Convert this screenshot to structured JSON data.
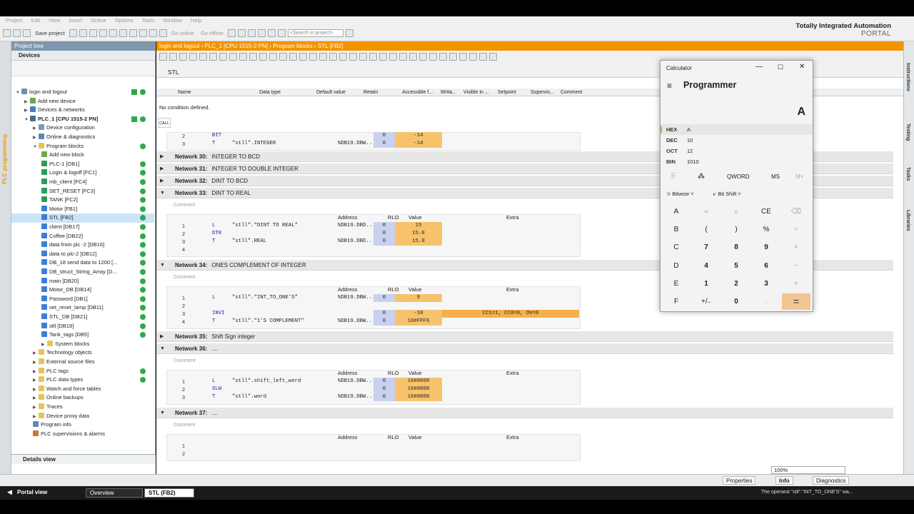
{
  "menu": [
    "Project",
    "Edit",
    "View",
    "Insert",
    "Online",
    "Options",
    "Tools",
    "Window",
    "Help"
  ],
  "toolbar": {
    "save_label": "Save project",
    "go_online": "Go online",
    "go_offline": "Go offline",
    "search_placeholder": "<Search in project>"
  },
  "brand": {
    "line1": "Totally Integrated Automation",
    "line2": "PORTAL"
  },
  "sidetab": "PLC programming",
  "project_tree": {
    "title": "Project tree",
    "tab": "Devices",
    "items": [
      {
        "label": "login and logout",
        "indent": 0,
        "icon": "project",
        "status": "check"
      },
      {
        "label": "Add new device",
        "indent": 1,
        "icon": "add"
      },
      {
        "label": "Devices & networks",
        "indent": 1,
        "icon": "network"
      },
      {
        "label": "PLC_1 [CPU 1515-2 PN]",
        "indent": 1,
        "icon": "plc",
        "status": "check",
        "bold": true
      },
      {
        "label": "Device configuration",
        "indent": 2,
        "icon": "config"
      },
      {
        "label": "Online & diagnostics",
        "indent": 2,
        "icon": "diag"
      },
      {
        "label": "Program blocks",
        "indent": 2,
        "icon": "folder",
        "status": "ok"
      },
      {
        "label": "Add new block",
        "indent": 3,
        "icon": "add"
      },
      {
        "label": "PLC-1 [OB1]",
        "indent": 3,
        "icon": "ob",
        "status": "ok"
      },
      {
        "label": "Login & logoff [FC1]",
        "indent": 3,
        "icon": "fc",
        "status": "ok"
      },
      {
        "label": "mb_client [FC4]",
        "indent": 3,
        "icon": "fc",
        "status": "ok"
      },
      {
        "label": "SET_RESET [FC3]",
        "indent": 3,
        "icon": "fc",
        "status": "ok"
      },
      {
        "label": "TANK [FC2]",
        "indent": 3,
        "icon": "fc",
        "status": "ok"
      },
      {
        "label": "Motor [FB1]",
        "indent": 3,
        "icon": "fb",
        "status": "ok"
      },
      {
        "label": "STL [FB2]",
        "indent": 3,
        "icon": "fb",
        "status": "ok",
        "selected": true
      },
      {
        "label": "client [DB17]",
        "indent": 3,
        "icon": "db",
        "status": "ok"
      },
      {
        "label": "Coffee [DB22]",
        "indent": 3,
        "icon": "db",
        "status": "ok"
      },
      {
        "label": "data from plc -2 [DB16]",
        "indent": 3,
        "icon": "db",
        "status": "ok"
      },
      {
        "label": "data to plc-2 [DB12]",
        "indent": 3,
        "icon": "db",
        "status": "ok"
      },
      {
        "label": "DB_18 send data to 1200 [...",
        "indent": 3,
        "icon": "db",
        "status": "ok"
      },
      {
        "label": "DB_struct_String_Array [D...",
        "indent": 3,
        "icon": "db",
        "status": "ok"
      },
      {
        "label": "main [DB20]",
        "indent": 3,
        "icon": "db",
        "status": "ok"
      },
      {
        "label": "Motor_DB [DB14]",
        "indent": 3,
        "icon": "db",
        "status": "ok"
      },
      {
        "label": "Password [DB1]",
        "indent": 3,
        "icon": "db",
        "status": "ok"
      },
      {
        "label": "set_reset_lamp [DB11]",
        "indent": 3,
        "icon": "db",
        "status": "ok"
      },
      {
        "label": "STL_DB [DB21]",
        "indent": 3,
        "icon": "db",
        "status": "ok"
      },
      {
        "label": "stll [DB19]",
        "indent": 3,
        "icon": "db",
        "status": "ok"
      },
      {
        "label": "Tank_tags [DB5]",
        "indent": 3,
        "icon": "db",
        "status": "ok"
      },
      {
        "label": "System blocks",
        "indent": 3,
        "icon": "folder"
      },
      {
        "label": "Technology objects",
        "indent": 2,
        "icon": "folder"
      },
      {
        "label": "External source files",
        "indent": 2,
        "icon": "folder"
      },
      {
        "label": "PLC tags",
        "indent": 2,
        "icon": "folder",
        "status": "ok"
      },
      {
        "label": "PLC data types",
        "indent": 2,
        "icon": "folder",
        "status": "ok"
      },
      {
        "label": "Watch and force tables",
        "indent": 2,
        "icon": "folder"
      },
      {
        "label": "Online backups",
        "indent": 2,
        "icon": "folder"
      },
      {
        "label": "Traces",
        "indent": 2,
        "icon": "folder"
      },
      {
        "label": "Device proxy data",
        "indent": 2,
        "icon": "folder"
      },
      {
        "label": "Program info",
        "indent": 2,
        "icon": "info"
      },
      {
        "label": "PLC supervisions & alarms",
        "indent": 2,
        "icon": "alarm"
      }
    ],
    "details": "Details view"
  },
  "editor": {
    "breadcrumb": "login and logout  ›  PLC_1 [CPU 1515-2 PN]  ›  Program blocks  ›  STL [FB2]",
    "lang": "STL",
    "interface_cols": [
      "Name",
      "Data type",
      "Default value",
      "Retain",
      "Accessible f...",
      "Writa...",
      "Visible in ...",
      "Setpoint",
      "Supervis...",
      "Comment"
    ],
    "condition": "No condition defined.",
    "call": "CALL",
    "col_headers": {
      "address": "Address",
      "rlo": "RLO",
      "value": "Value",
      "extra": "Extra"
    },
    "comment_placeholder": "Comment",
    "top_lines": [
      {
        "no": "2",
        "ins": "BIT",
        "opd": "",
        "addr": "",
        "rlo": "0",
        "val": "-14"
      },
      {
        "no": "3",
        "ins": "T",
        "opd": "\"stll\".INTEGER",
        "addr": "%DB19.DBW...",
        "rlo": "0",
        "val": "-14"
      }
    ],
    "networks": [
      {
        "id": "n30",
        "title": "Network 30:",
        "desc": "INTEGER TO BCD",
        "open": false
      },
      {
        "id": "n31",
        "title": "Network 31:",
        "desc": "INTEGER TO DOUBLE INTEGER",
        "open": false
      },
      {
        "id": "n32",
        "title": "Network 32:",
        "desc": "DINT TO BCD",
        "open": false
      },
      {
        "id": "n33",
        "title": "Network 33:",
        "desc": "DINT TO REAL",
        "open": true,
        "lines": [
          {
            "no": "1",
            "ins": "L",
            "opd": "\"stll\".\"DINT TO REAL\"",
            "addr": "%DB19.DBD...",
            "rlo": "0",
            "val": "15"
          },
          {
            "no": "2",
            "ins": "DTR",
            "opd": "",
            "addr": "",
            "rlo": "0",
            "val": "15.0"
          },
          {
            "no": "3",
            "ins": "T",
            "opd": "\"stll\".REAL",
            "addr": "%DB19.DBD...",
            "rlo": "0",
            "val": "15.0"
          },
          {
            "no": "4",
            "ins": "",
            "opd": "",
            "addr": "",
            "rlo": "",
            "val": ""
          }
        ]
      },
      {
        "id": "n34",
        "title": "Network 34:",
        "desc": "ONES COMPLEMENT OF INTEGER",
        "open": true,
        "lines": [
          {
            "no": "1",
            "ins": "L",
            "opd": "\"stll\".\"INT_TO_ONE'S\"",
            "addr": "%DB19.DBW...",
            "rlo": "0",
            "val": "9"
          },
          {
            "no": "2",
            "ins": "",
            "opd": "",
            "addr": "",
            "rlo": "",
            "val": ""
          },
          {
            "no": "3",
            "ins": "INVI",
            "opd": "",
            "addr": "",
            "rlo": "0",
            "val": "-10",
            "ext": "CC1=1, CC0=0, OV=0"
          },
          {
            "no": "4",
            "ins": "T",
            "opd": "\"stll\".\"1'S COMPLEMENT\"",
            "addr": "%DB19.DBW...",
            "rlo": "0",
            "val": "16#FFF6"
          }
        ]
      },
      {
        "id": "n35",
        "title": "Network 35:",
        "desc": "Shift Sign integer",
        "open": false
      },
      {
        "id": "n36",
        "title": "Network 36:",
        "desc": "....",
        "open": true,
        "lines": [
          {
            "no": "1",
            "ins": "L",
            "opd": "\"stll\".shift_left_word",
            "addr": "%DB19.DBW...",
            "rlo": "0",
            "val": "16#0000"
          },
          {
            "no": "2",
            "ins": "SLW",
            "opd": "",
            "addr": "",
            "rlo": "0",
            "val": "16#0000"
          },
          {
            "no": "3",
            "ins": "T",
            "opd": "\"stll\".word",
            "addr": "%DB19.DBW...",
            "rlo": "0",
            "val": "16#0000"
          }
        ]
      },
      {
        "id": "n37",
        "title": "Network 37:",
        "desc": "....",
        "open": true,
        "lines": [
          {
            "no": "1",
            "ins": "",
            "opd": "",
            "addr": "",
            "rlo": "",
            "val": ""
          },
          {
            "no": "2",
            "ins": "",
            "opd": "",
            "addr": "",
            "rlo": "",
            "val": ""
          }
        ]
      }
    ],
    "zoom": "100%"
  },
  "calculator": {
    "title": "Calculator",
    "mode": "Programmer",
    "display": "A",
    "radix": [
      {
        "name": "HEX",
        "value": "A",
        "active": true
      },
      {
        "name": "DEC",
        "value": "10"
      },
      {
        "name": "OCT",
        "value": "12"
      },
      {
        "name": "BIN",
        "value": "1010"
      }
    ],
    "word_size": "QWORD",
    "ms": "MS",
    "mminus": "M˅",
    "bitwise": "Bitwise",
    "bitshift": "Bit Shift",
    "keys": [
      [
        "A",
        "«",
        "»",
        "CE",
        "⌫"
      ],
      [
        "B",
        "(",
        ")",
        "%",
        "÷"
      ],
      [
        "C",
        "7",
        "8",
        "9",
        "×"
      ],
      [
        "D",
        "4",
        "5",
        "6",
        "−"
      ],
      [
        "E",
        "1",
        "2",
        "3",
        "+"
      ],
      [
        "F",
        "+/₋",
        "0",
        ".",
        "="
      ]
    ]
  },
  "right_tabs": [
    "Instructions",
    "Testing",
    "Tasks",
    "Libraries"
  ],
  "status": {
    "properties": "Properties",
    "info": "Info",
    "diagnostics": "Diagnostics"
  },
  "taskbar": {
    "portal_view": "Portal view",
    "overview": "Overview",
    "stl": "STL (FB2)",
    "message": "The operand \"stll\".\"INT_TO_ONE'S\" wa..."
  },
  "colors": {
    "accent": "#f29400",
    "value_bg": "#f6c36c",
    "rlo_bg": "#c8d2ee",
    "status_ok": "#2fa84a",
    "tree_header": "#7f97ad"
  }
}
